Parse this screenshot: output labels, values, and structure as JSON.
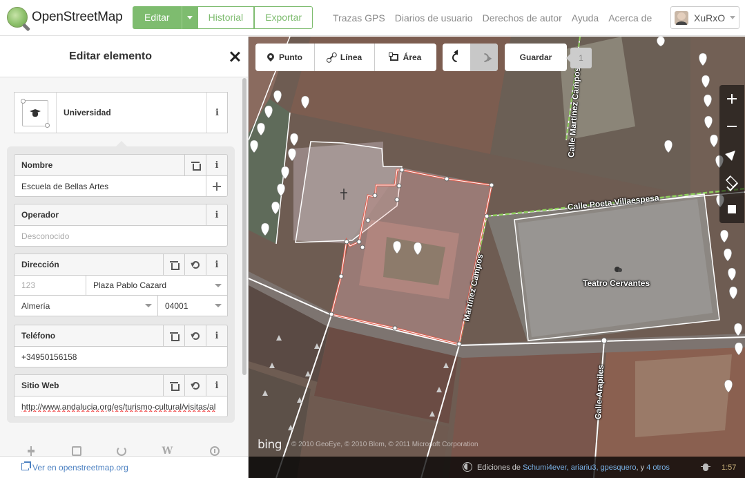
{
  "header": {
    "brand": "OpenStreetMap",
    "edit_label": "Editar",
    "history_label": "Historial",
    "export_label": "Exportar",
    "nav": [
      "Trazas GPS",
      "Diarios de usuario",
      "Derechos de autor",
      "Ayuda",
      "Acerca de"
    ],
    "username": "XuRxO"
  },
  "sidebar": {
    "title": "Editar elemento",
    "preset": {
      "name": "Universidad",
      "icon": "college-icon"
    },
    "fields": {
      "name": {
        "label": "Nombre",
        "value": "Escuela de Bellas Artes"
      },
      "operator": {
        "label": "Operador",
        "placeholder": "Desconocido"
      },
      "address": {
        "label": "Dirección",
        "housenumber_placeholder": "123",
        "street": "Plaza Pablo Cazard",
        "city": "Almería",
        "postcode": "04001"
      },
      "phone": {
        "label": "Teléfono",
        "value": "+34950156158"
      },
      "website": {
        "label": "Sitio Web",
        "value": "http://www.andalucia.org/es/turismo-cultural/visitas/al"
      }
    },
    "footer_link": "Ver en openstreetmap.org"
  },
  "map": {
    "modes": [
      {
        "label": "Punto",
        "icon": "point-icon"
      },
      {
        "label": "Línea",
        "icon": "line-icon"
      },
      {
        "label": "Área",
        "icon": "area-icon"
      }
    ],
    "save_label": "Guardar",
    "save_count": "1",
    "streets": [
      "Calle Martínez Campos",
      "Calle Poeta Villaespesa",
      "Martínez Campos",
      "Calle Arapiles"
    ],
    "poi": "Teatro Cervantes",
    "bing": "bing",
    "imagery_copyright": "© 2010 GeoEye, © 2010 Blom, © 2011 Microsoft Corporation",
    "attribution": {
      "prefix": "Ediciones de",
      "users": "Schumi4ever, ariariu3, gpesquero",
      "joiner": ", y",
      "others": "4 otros"
    },
    "scale": "1:57"
  },
  "colors": {
    "accent": "#7ebc6f",
    "selected_area": "#e06050",
    "link": "#4b80c1"
  }
}
